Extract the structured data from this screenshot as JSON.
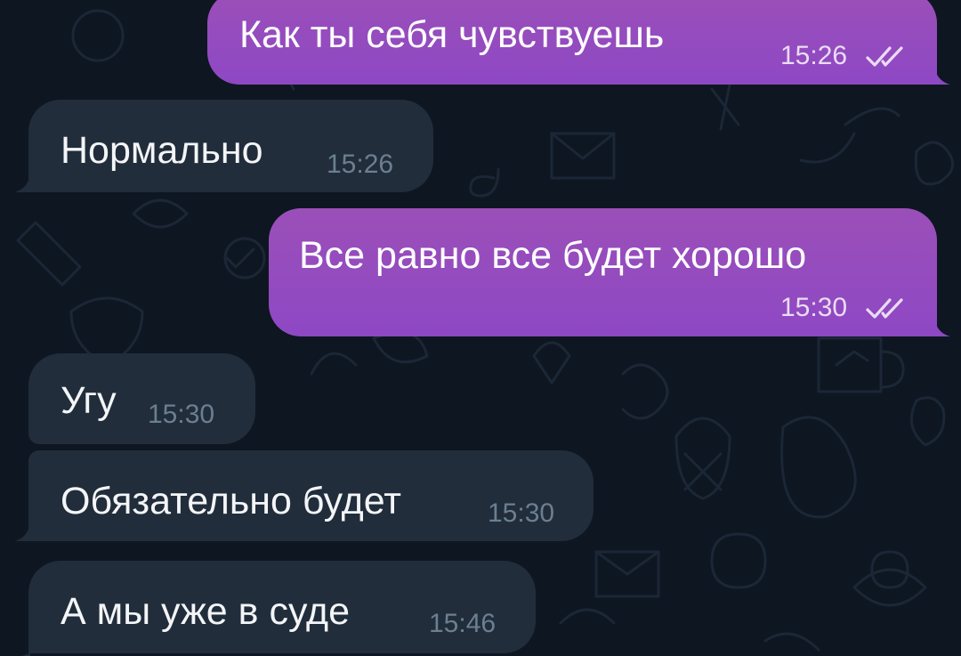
{
  "chat": {
    "messages": [
      {
        "direction": "out",
        "text": "Как ты себя чувствуешь",
        "time": "15:26",
        "status": "read"
      },
      {
        "direction": "in",
        "text": "Нормально",
        "time": "15:26"
      },
      {
        "direction": "out",
        "text": "Все равно все будет хорошо",
        "time": "15:30",
        "status": "read"
      },
      {
        "direction": "in",
        "text": "Угу",
        "time": "15:30"
      },
      {
        "direction": "in",
        "text": "Обязательно будет",
        "time": "15:30"
      },
      {
        "direction": "in",
        "text": "А мы уже в суде",
        "time": "15:46"
      }
    ]
  },
  "colors": {
    "background": "#0e1621",
    "outgoing_bubble": "#9b4fb8",
    "incoming_bubble": "#212d3b",
    "outgoing_meta": "#eadcf3",
    "incoming_meta": "#6b7f91"
  },
  "icons": {
    "read_status": "double-check-icon",
    "background": "doodle-pattern"
  }
}
